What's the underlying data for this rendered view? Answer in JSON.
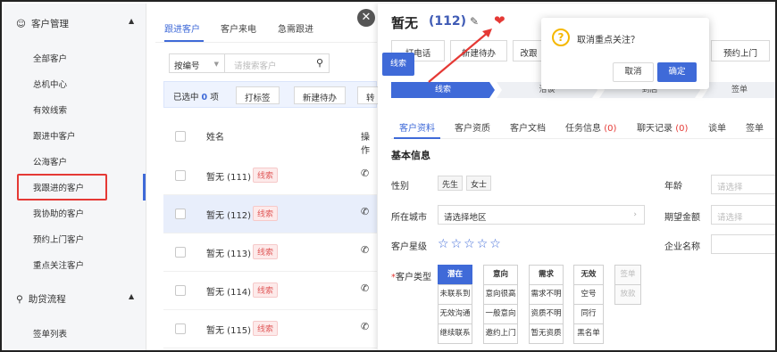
{
  "sidebar": {
    "group1": {
      "label": "客户管理"
    },
    "items": [
      {
        "label": "全部客户"
      },
      {
        "label": "总机中心"
      },
      {
        "label": "有效线索"
      },
      {
        "label": "跟进中客户"
      },
      {
        "label": "公海客户"
      },
      {
        "label": "我跟进的客户"
      },
      {
        "label": "我协助的客户"
      },
      {
        "label": "预约上门客户"
      },
      {
        "label": "重点关注客户"
      }
    ],
    "group2": {
      "label": "助贷流程"
    },
    "items2": [
      {
        "label": "签单列表"
      }
    ]
  },
  "list": {
    "tabs": [
      {
        "label": "跟进客户"
      },
      {
        "label": "客户来电"
      },
      {
        "label": "急需跟进"
      }
    ],
    "select_value": "按编号",
    "search_placeholder": "请搜索客户",
    "selected_prefix": "已选中",
    "selected_count": "0",
    "selected_suffix": "项",
    "bulk_buttons": [
      {
        "label": "打标签"
      },
      {
        "label": "新建待办"
      },
      {
        "label": "转"
      }
    ],
    "header_name": "姓名",
    "header_op": "操作",
    "rows": [
      {
        "name": "暂无 (111)",
        "tag": "线索"
      },
      {
        "name": "暂无 (112)",
        "tag": "线索"
      },
      {
        "name": "暂无 (113)",
        "tag": "线索"
      },
      {
        "name": "暂无 (114)",
        "tag": "线索"
      },
      {
        "name": "暂无 (115)",
        "tag": "线索"
      }
    ]
  },
  "detail": {
    "name": "暂无",
    "id": "(112)",
    "actions": [
      {
        "label": "打电话"
      },
      {
        "label": "新建待办"
      },
      {
        "label": "改跟"
      },
      {
        "label": "预约上门"
      }
    ],
    "tooltip": "线索",
    "stages": [
      {
        "label": "线索"
      },
      {
        "label": "洽谈"
      },
      {
        "label": "到店"
      },
      {
        "label": "签单"
      }
    ],
    "tabs": [
      {
        "label": "客户资料",
        "count": ""
      },
      {
        "label": "客户资质",
        "count": ""
      },
      {
        "label": "客户文档",
        "count": ""
      },
      {
        "label": "任务信息",
        "count": "(0)"
      },
      {
        "label": "聊天记录",
        "count": "(0)"
      },
      {
        "label": "谈单",
        "count": ""
      },
      {
        "label": "签单",
        "count": ""
      }
    ],
    "section_title": "基本信息",
    "fields": {
      "gender_label": "性别",
      "gender_options": [
        "先生",
        "女士"
      ],
      "age_label": "年龄",
      "age_placeholder": "请选择",
      "city_label": "所在城市",
      "city_value": "请选择地区",
      "amount_label": "期望金额",
      "amount_placeholder": "请选择",
      "star_label": "客户星级",
      "star_rating": 0,
      "star_max": 5,
      "company_label": "企业名称",
      "type_label": "客户类型",
      "type_required": "*"
    },
    "type_grid": [
      {
        "header": "潜在",
        "items": [
          "未联系到",
          "无效沟通",
          "继续联系"
        ],
        "active_header": true
      },
      {
        "header": "意向",
        "items": [
          "意向很高",
          "一般意向",
          "邀约上门"
        ]
      },
      {
        "header": "需求",
        "items": [
          "需求不明",
          "资质不明",
          "暂无资质"
        ]
      },
      {
        "header": "无效",
        "items": [
          "空号",
          "同行",
          "黑名单"
        ]
      },
      {
        "header": "签单",
        "items": [
          "放款"
        ],
        "disabled": true
      }
    ]
  },
  "dialog": {
    "message": "取消重点关注？",
    "cancel": "取消",
    "confirm": "确定"
  },
  "colors": {
    "primary": "#3f6ad8",
    "danger": "#e53935",
    "warning": "#f5b800"
  }
}
